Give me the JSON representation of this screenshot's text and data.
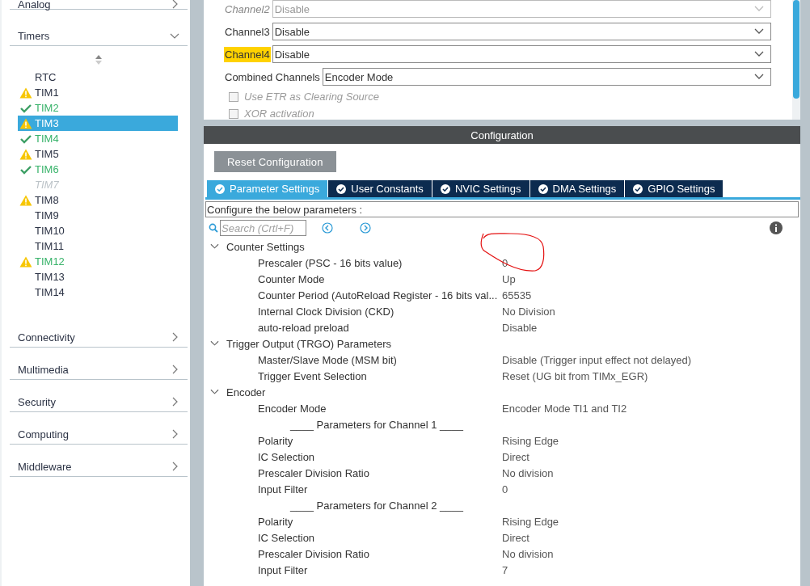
{
  "sidebar": {
    "categories_top": [
      {
        "label": "Analog",
        "expanded": false
      },
      {
        "label": "Timers",
        "expanded": true
      }
    ],
    "items": [
      {
        "label": "RTC",
        "kind": "plain",
        "configured": false,
        "disabled": false,
        "selected": false
      },
      {
        "label": "TIM1",
        "kind": "warning",
        "configured": false,
        "disabled": false,
        "selected": false
      },
      {
        "label": "TIM2",
        "kind": "ok",
        "configured": true,
        "disabled": false,
        "selected": false
      },
      {
        "label": "TIM3",
        "kind": "warning",
        "configured": false,
        "disabled": false,
        "selected": true
      },
      {
        "label": "TIM4",
        "kind": "ok",
        "configured": true,
        "disabled": false,
        "selected": false
      },
      {
        "label": "TIM5",
        "kind": "warning",
        "configured": false,
        "disabled": false,
        "selected": false
      },
      {
        "label": "TIM6",
        "kind": "ok",
        "configured": true,
        "disabled": false,
        "selected": false
      },
      {
        "label": "TIM7",
        "kind": "plain",
        "configured": false,
        "disabled": true,
        "selected": false
      },
      {
        "label": "TIM8",
        "kind": "warning",
        "configured": false,
        "disabled": false,
        "selected": false
      },
      {
        "label": "TIM9",
        "kind": "plain",
        "configured": false,
        "disabled": false,
        "selected": false
      },
      {
        "label": "TIM10",
        "kind": "plain",
        "configured": false,
        "disabled": false,
        "selected": false
      },
      {
        "label": "TIM11",
        "kind": "plain",
        "configured": false,
        "disabled": false,
        "selected": false
      },
      {
        "label": "TIM12",
        "kind": "warning",
        "configured": true,
        "disabled": false,
        "selected": false
      },
      {
        "label": "TIM13",
        "kind": "plain",
        "configured": false,
        "disabled": false,
        "selected": false
      },
      {
        "label": "TIM14",
        "kind": "plain",
        "configured": false,
        "disabled": false,
        "selected": false
      }
    ],
    "categories_bottom": [
      {
        "label": "Connectivity",
        "expanded": false
      },
      {
        "label": "Multimedia",
        "expanded": false
      },
      {
        "label": "Security",
        "expanded": false
      },
      {
        "label": "Computing",
        "expanded": false
      },
      {
        "label": "Middleware",
        "expanded": false
      }
    ]
  },
  "mode": {
    "channels": [
      {
        "label": "Channel2",
        "value": "Disable",
        "disabled": true,
        "highlighted": false
      },
      {
        "label": "Channel3",
        "value": "Disable",
        "disabled": false,
        "highlighted": false
      },
      {
        "label": "Channel4",
        "value": "Disable",
        "disabled": false,
        "highlighted": true
      },
      {
        "label": "Combined Channels",
        "value": "Encoder Mode",
        "disabled": false,
        "highlighted": false
      }
    ],
    "options": [
      {
        "label": "Use ETR as Clearing Source",
        "checked": false,
        "disabled": true
      },
      {
        "label": "XOR activation",
        "checked": false,
        "disabled": true
      }
    ]
  },
  "configuration": {
    "title": "Configuration",
    "reset_button": "Reset Configuration",
    "tabs": [
      {
        "label": "Parameter Settings",
        "selected": true
      },
      {
        "label": "User Constants",
        "selected": false
      },
      {
        "label": "NVIC Settings",
        "selected": false
      },
      {
        "label": "DMA Settings",
        "selected": false
      },
      {
        "label": "GPIO Settings",
        "selected": false
      }
    ],
    "hint": "Configure the below parameters :",
    "search": {
      "placeholder": "Search (Crtl+F)"
    },
    "groups": [
      {
        "label": "Counter Settings",
        "expanded": true,
        "rows": [
          {
            "kind": "param",
            "name": "Prescaler (PSC - 16 bits value)",
            "value": "0"
          },
          {
            "kind": "param",
            "name": "Counter Mode",
            "value": "Up"
          },
          {
            "kind": "param",
            "name": "Counter Period (AutoReload Register - 16 bits val...",
            "value": "65535"
          },
          {
            "kind": "param",
            "name": "Internal Clock Division (CKD)",
            "value": "No Division"
          },
          {
            "kind": "param",
            "name": "auto-reload preload",
            "value": "Disable"
          }
        ]
      },
      {
        "label": "Trigger Output (TRGO) Parameters",
        "expanded": true,
        "rows": [
          {
            "kind": "param",
            "name": "Master/Slave Mode (MSM bit)",
            "value": "Disable (Trigger input effect not delayed)"
          },
          {
            "kind": "param",
            "name": "Trigger Event Selection",
            "value": "Reset (UG bit from TIMx_EGR)"
          }
        ]
      },
      {
        "label": "Encoder",
        "expanded": true,
        "rows": [
          {
            "kind": "param",
            "name": "Encoder Mode",
            "value": "Encoder Mode TI1 and TI2"
          },
          {
            "kind": "heading",
            "name": "____ Parameters for Channel 1 ____"
          },
          {
            "kind": "param",
            "name": "Polarity",
            "value": "Rising Edge"
          },
          {
            "kind": "param",
            "name": "IC Selection",
            "value": "Direct"
          },
          {
            "kind": "param",
            "name": "Prescaler Division Ratio",
            "value": "No division"
          },
          {
            "kind": "param",
            "name": "Input Filter",
            "value": "0"
          },
          {
            "kind": "heading",
            "name": "____ Parameters for Channel 2 ____"
          },
          {
            "kind": "param",
            "name": "Polarity",
            "value": "Rising Edge"
          },
          {
            "kind": "param",
            "name": "IC Selection",
            "value": "Direct"
          },
          {
            "kind": "param",
            "name": "Prescaler Division Ratio",
            "value": "No division"
          },
          {
            "kind": "param",
            "name": "Input Filter",
            "value": "7"
          }
        ]
      }
    ]
  }
}
